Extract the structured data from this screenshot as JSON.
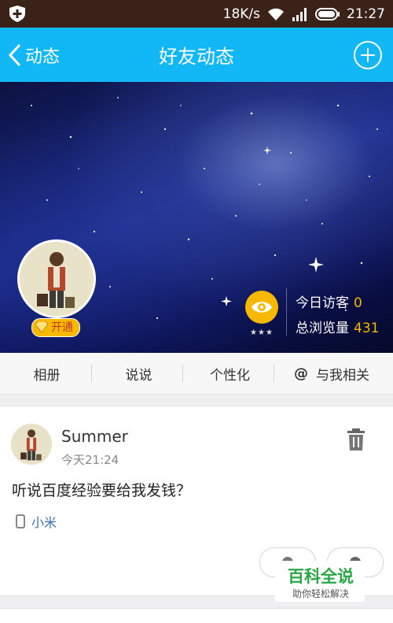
{
  "status_bar": {
    "speed": "18K/s",
    "time": "21:27"
  },
  "navbar": {
    "back_label": "动态",
    "title": "好友动态"
  },
  "profile": {
    "vip_label": "开通",
    "visitors_today_label": "今日访客",
    "visitors_today": "0",
    "total_views_label": "总浏览量",
    "total_views": "431"
  },
  "tabs": [
    "相册",
    "说说",
    "个性化",
    "与我相关"
  ],
  "tab_at_symbol": "@",
  "post": {
    "author": "Summer",
    "time": "今天21:24",
    "text": "听说百度经验要给我发钱？",
    "device": "小米"
  },
  "watermark": {
    "title": "百科全说",
    "subtitle": "助你轻松解决"
  },
  "colors": {
    "nav": "#12b7f5",
    "status_bar": "#3b2218",
    "accent": "#f6b800",
    "device_link": "#3b6fb6"
  },
  "icons": [
    "shield-icon",
    "wifi-icon",
    "signal-icon",
    "battery-icon",
    "back-chevron-icon",
    "add-icon",
    "eye-icon",
    "gem-icon",
    "trash-icon",
    "phone-icon"
  ]
}
